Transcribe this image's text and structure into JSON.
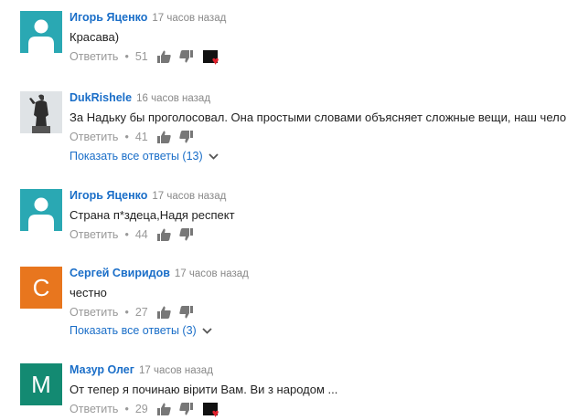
{
  "actions": {
    "reply_label": "Ответить",
    "separator": "•"
  },
  "comments": [
    {
      "author": "Игорь Яценко",
      "timestamp": "17 часов назад",
      "text": "Красава)",
      "likes": "51",
      "avatar": {
        "type": "default",
        "color": "#2aa8b3"
      },
      "creator_heart": true
    },
    {
      "author": "DukRishele",
      "timestamp": "16 часов назад",
      "text": "За Надьку бы проголосовал. Она простыми словами объясняет сложные вещи, наш человек.",
      "likes": "41",
      "avatar": {
        "type": "photo"
      },
      "show_replies": "Показать все ответы (13)"
    },
    {
      "author": "Игорь Яценко",
      "timestamp": "17 часов назад",
      "text": "Страна п*здеца,Надя респект",
      "likes": "44",
      "avatar": {
        "type": "default",
        "color": "#2aa8b3"
      }
    },
    {
      "author": "Сергей Свиридов",
      "timestamp": "17 часов назад",
      "text": "честно",
      "likes": "27",
      "avatar": {
        "type": "letter",
        "letter": "С",
        "color": "#e8761e"
      },
      "show_replies": "Показать все ответы (3)"
    },
    {
      "author": "Мазур Олег",
      "timestamp": "17 часов назад",
      "text": "От тепер я починаю вірити Вам. Ви з народом ...",
      "likes": "29",
      "avatar": {
        "type": "letter",
        "letter": "М",
        "color": "#138a72"
      },
      "creator_heart": true
    }
  ],
  "colors": {
    "link": "#1a6ec8",
    "meta": "#999999",
    "heart": "#e0202c"
  }
}
